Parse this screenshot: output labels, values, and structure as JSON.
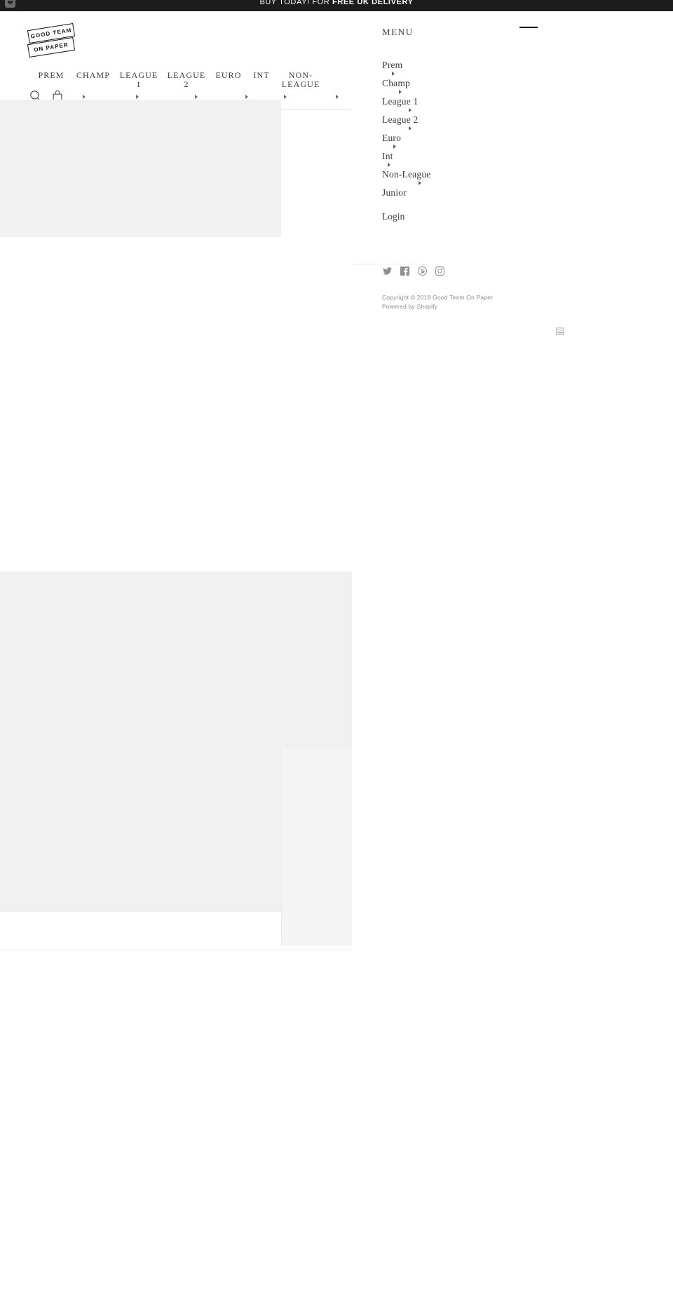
{
  "announcement": {
    "prefix": "BUY TODAY! FOR ",
    "emphasis": "FREE UK DELIVERY",
    "favicon_icon": "shop-favicon-icon"
  },
  "brand": {
    "logo_line_1": "GOOD TEAM",
    "logo_line_2": "ON PAPER",
    "name": "Good Team On Paper"
  },
  "header": {
    "nav": [
      {
        "label": "PREM",
        "caret": "▸"
      },
      {
        "label": "CHAMP",
        "caret": "▸"
      },
      {
        "label": "LEAGUE\n1",
        "caret": "▸"
      },
      {
        "label": "LEAGUE\n2",
        "caret": "▸"
      },
      {
        "label": "EURO",
        "caret": "▸"
      },
      {
        "label": "INT",
        "caret": "▸"
      },
      {
        "label": "NON-LEAGUE",
        "caret": "▸"
      }
    ],
    "search_icon": "search-icon",
    "cart_icon": "cart-icon"
  },
  "drawer": {
    "title": "MENU",
    "close_icon": "hamburger-close-icon",
    "items": [
      {
        "label": "Prem",
        "has_caret": true
      },
      {
        "label": "Champ",
        "has_caret": true
      },
      {
        "label": "League 1",
        "has_caret": true
      },
      {
        "label": "League 2",
        "has_caret": true
      },
      {
        "label": "Euro",
        "has_caret": true
      },
      {
        "label": "Int",
        "has_caret": true
      },
      {
        "label": "Non-League",
        "has_caret": true
      },
      {
        "label": "Junior",
        "has_caret": false
      }
    ],
    "login_label": "Login",
    "social": [
      {
        "name": "twitter-icon",
        "label": "Twitter"
      },
      {
        "name": "facebook-icon",
        "label": "Facebook"
      },
      {
        "name": "pinterest-icon",
        "label": "Pinterest"
      },
      {
        "name": "instagram-icon",
        "label": "Instagram"
      }
    ],
    "copyright": "Copyright © 2018 Good Team On Paper",
    "powered_by": "Powered by Shopify"
  },
  "colors": {
    "announcement_bg": "#1c1c1c",
    "text": "#3c3c3c",
    "muted": "#8c8c8c",
    "placeholder": "#f1f1f1",
    "rule": "#ececec"
  }
}
